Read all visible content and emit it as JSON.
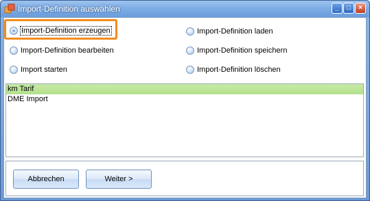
{
  "window": {
    "title": "Import-Definition auswählen",
    "controls": {
      "minimize": "_",
      "maximize": "□",
      "close": "×"
    }
  },
  "options": [
    {
      "label": "Import-Definition erzeugen",
      "checked": true
    },
    {
      "label": "Import-Definition bearbeiten",
      "checked": false
    },
    {
      "label": "Import starten",
      "checked": false
    },
    {
      "label": "Import-Definition laden",
      "checked": false
    },
    {
      "label": "Import-Definition speichern",
      "checked": false
    },
    {
      "label": "Import-Definition löschen",
      "checked": false
    }
  ],
  "list": {
    "items": [
      {
        "label": "km Tarif",
        "selected": true
      },
      {
        "label": "DME Import",
        "selected": false
      }
    ]
  },
  "buttons": {
    "cancel": "Abbrechen",
    "next": "Weiter >"
  },
  "colors": {
    "highlight": "#f28c1c",
    "selected_row": "#c7eaa7",
    "titlebar": "#7faee5"
  }
}
